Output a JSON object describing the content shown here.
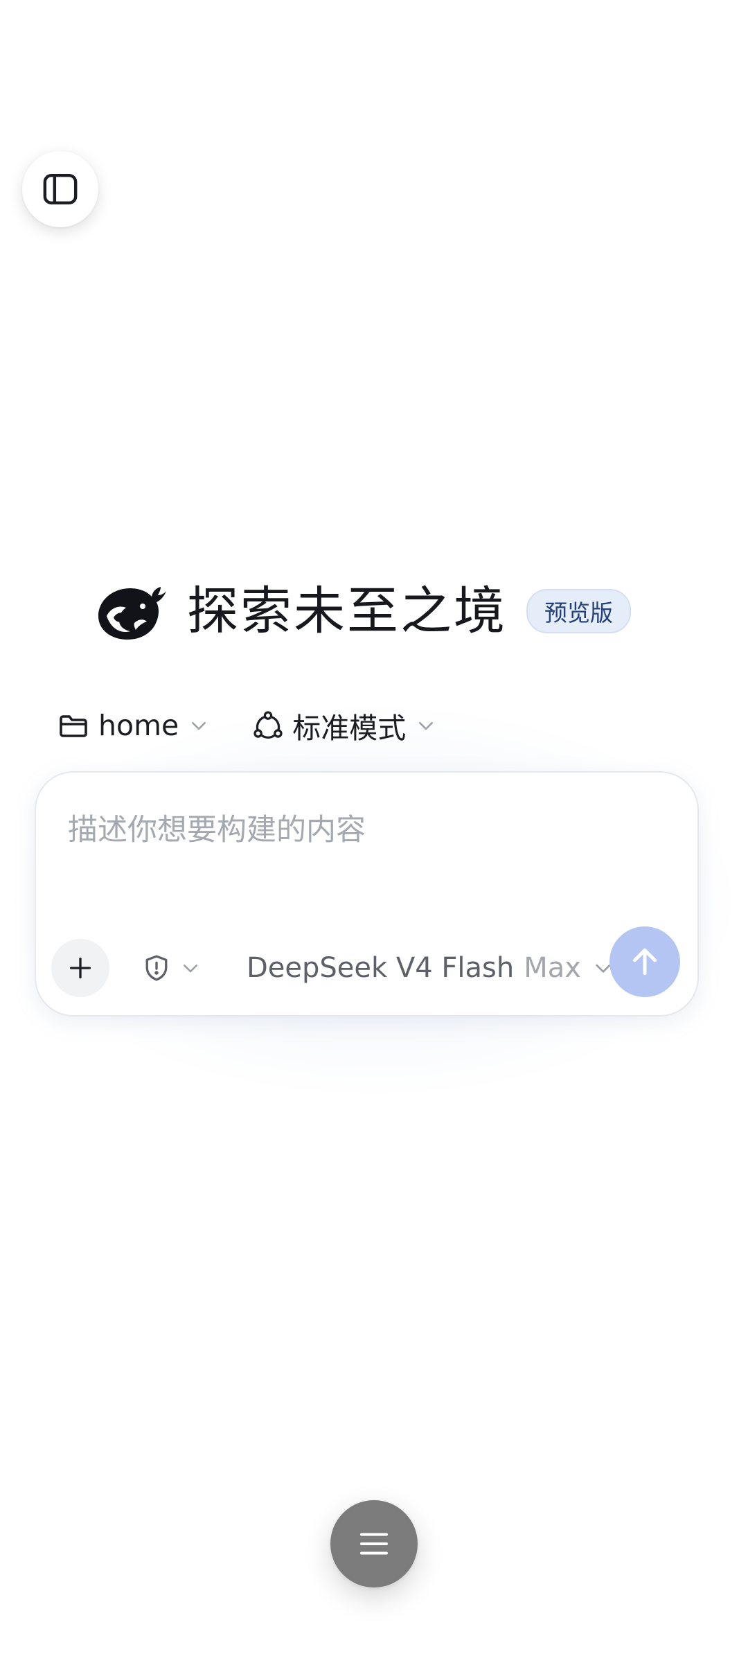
{
  "hero": {
    "title": "探索未至之境",
    "badge": "预览版",
    "logo_icon": "whale-logo-icon"
  },
  "selectors": {
    "folder": {
      "label": "home",
      "icon": "folder-icon"
    },
    "mode": {
      "label": "标准模式",
      "icon": "agent-mode-icon"
    }
  },
  "composer": {
    "placeholder": "描述你想要构建的内容",
    "value": "",
    "model_name": "DeepSeek V4 Flash",
    "model_effort": "Max",
    "add_icon": "plus-icon",
    "permission_icon": "shield-alert-icon",
    "send_icon": "arrow-up-icon"
  },
  "colors": {
    "accent_send": "#b4c5f3",
    "badge_bg": "#e5edf9",
    "badge_text": "#24407a",
    "fab_bg": "#7b7b7b",
    "placeholder": "#a4a8b0"
  }
}
